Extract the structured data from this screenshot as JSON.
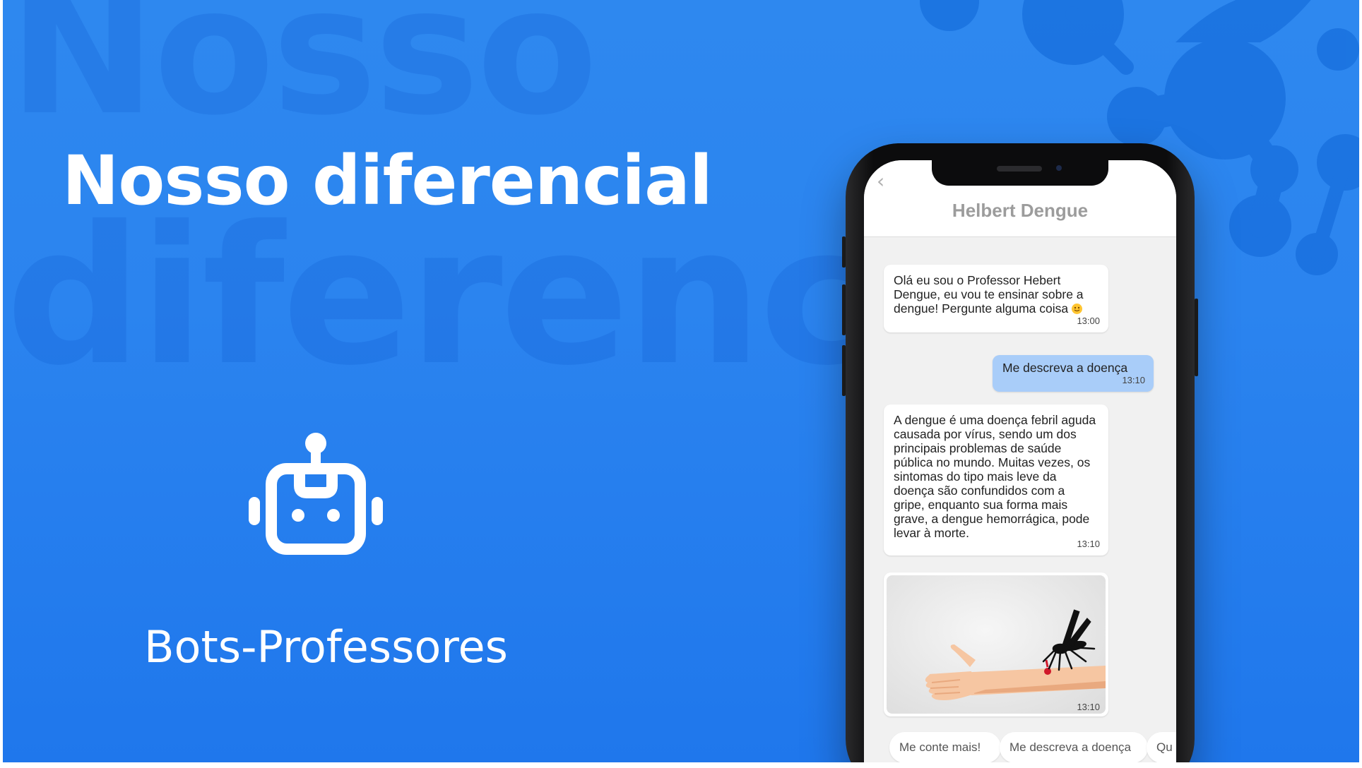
{
  "slide": {
    "background_word_1": "Nosso",
    "background_word_2": "diferencial",
    "title": "Nosso diferencial",
    "subtitle": "Bots-Professores",
    "icon": "robot-icon",
    "colors": {
      "background": "#2b84ef",
      "title": "#ffffff"
    }
  },
  "phone": {
    "chat_title": "Helbert Dengue",
    "back_icon": "chevron-left-icon",
    "messages": [
      {
        "sender": "bot",
        "lines": [
          "Olá eu sou o Professor Hebert",
          "Dengue, eu vou te ensinar sobre a",
          "dengue! Pergunte alguma coisa"
        ],
        "emoji": "smiling-face-emoji",
        "time": "13:00"
      },
      {
        "sender": "user",
        "lines": [
          "Me descreva a doença"
        ],
        "time": "13:10"
      },
      {
        "sender": "bot",
        "lines": [
          "A dengue é uma doença febril aguda",
          "causada por vírus, sendo um dos",
          "principais problemas de saúde",
          "pública no mundo. Muitas vezes, os",
          "sintomas do tipo mais leve da",
          "doença são confundidos com a",
          "gripe, enquanto sua forma mais",
          "grave, a dengue hemorrágica, pode",
          "levar à morte."
        ],
        "time": "13:10"
      },
      {
        "sender": "bot",
        "type": "image",
        "image": "mosquito-biting-arm-illustration",
        "time": "13:10"
      }
    ],
    "quick_replies": [
      "Me conte mais!",
      "Me descreva a doença",
      "Qu"
    ],
    "colors": {
      "user_bubble": "#a9cdf9",
      "bot_bubble": "#ffffff",
      "chat_background": "#f1f1f1"
    }
  }
}
